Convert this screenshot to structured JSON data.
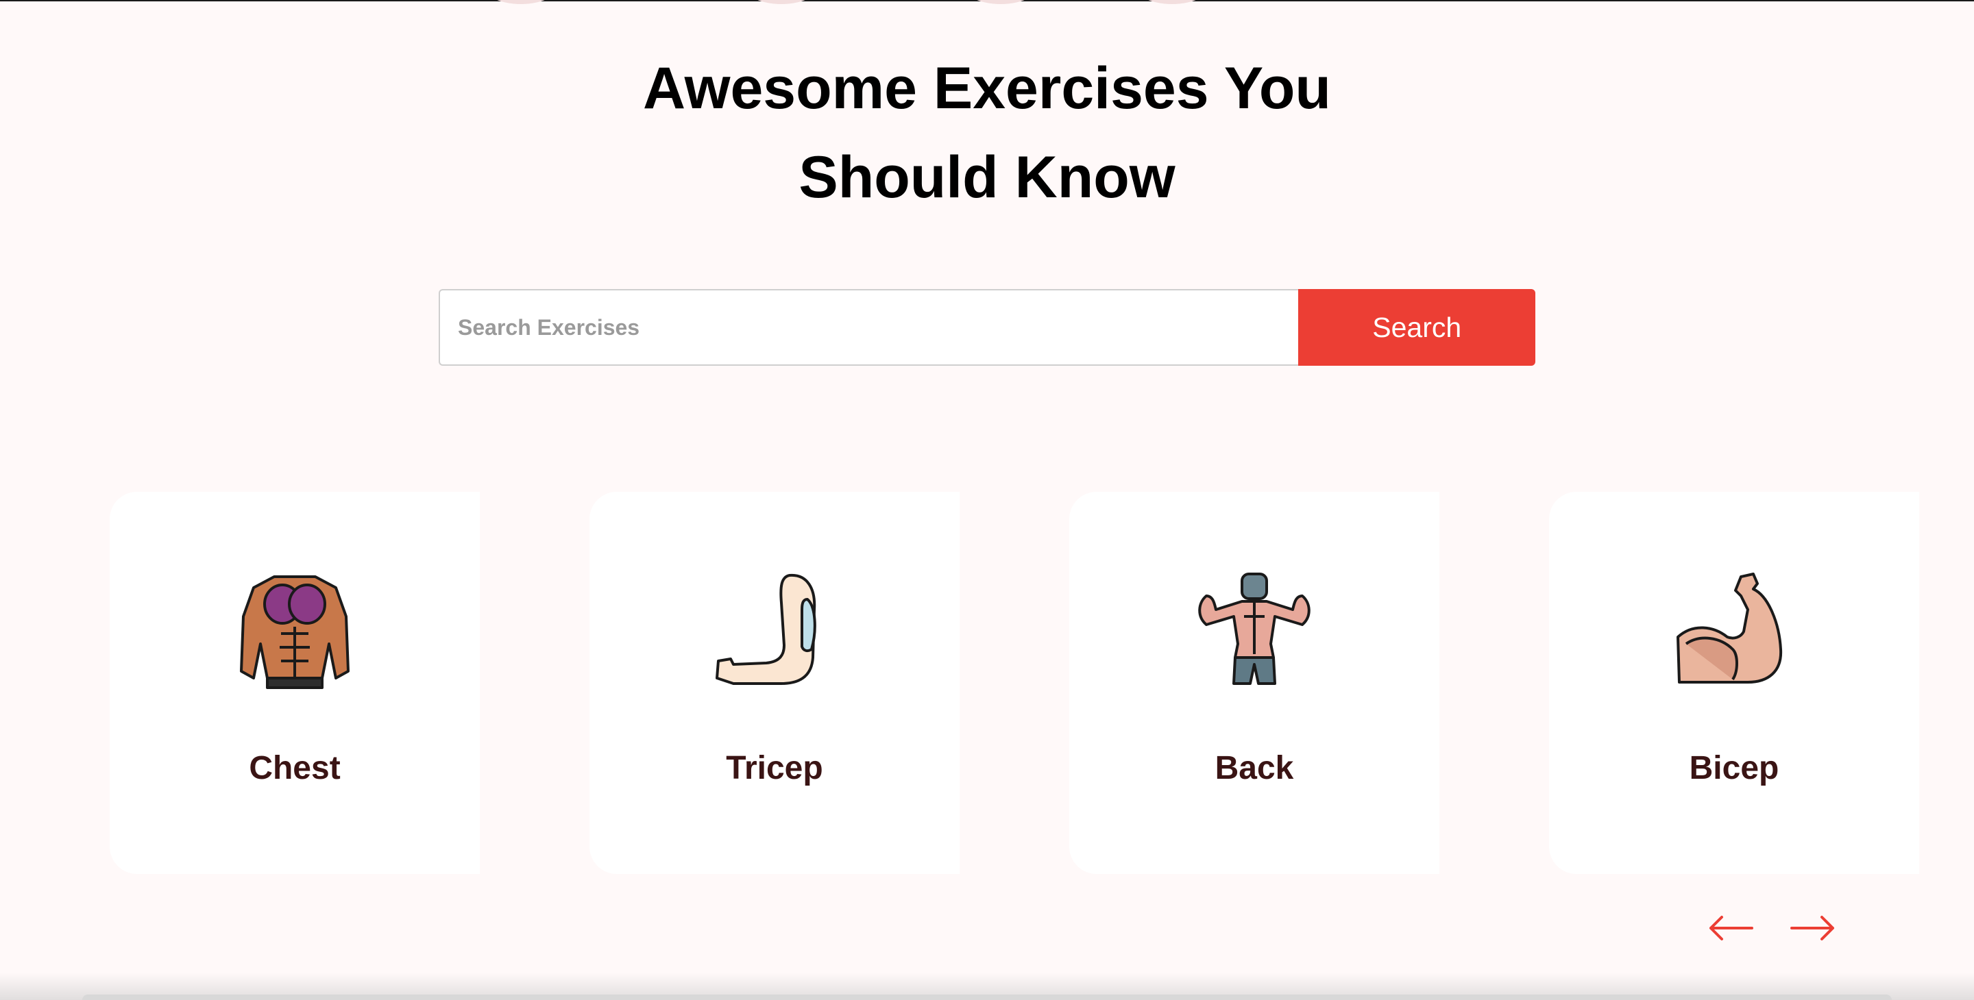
{
  "hero": {
    "title_line1": "Awesome Exercises You",
    "title_line2": "Should Know"
  },
  "search": {
    "placeholder": "Search Exercises",
    "value": "",
    "button_label": "Search"
  },
  "body_parts": [
    {
      "label": "Chest",
      "icon": "chest-muscles-icon"
    },
    {
      "label": "Tricep",
      "icon": "tricep-arm-icon"
    },
    {
      "label": "Back",
      "icon": "back-muscles-icon"
    },
    {
      "label": "Bicep",
      "icon": "bicep-flex-icon"
    }
  ],
  "carousel": {
    "prev_icon": "arrow-left-icon",
    "next_icon": "arrow-right-icon"
  },
  "colors": {
    "accent": "#ec3e34",
    "background": "#fff9f9",
    "card_label": "#3a1414"
  }
}
